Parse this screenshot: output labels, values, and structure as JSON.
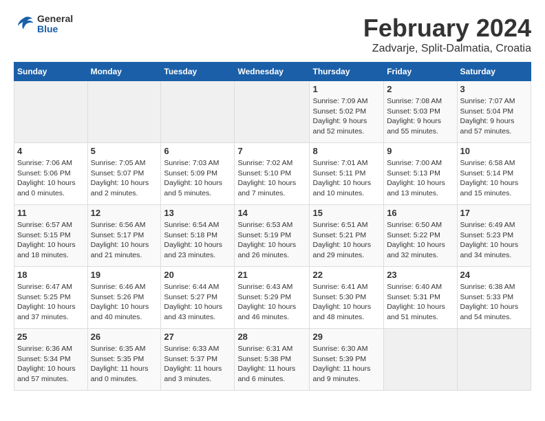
{
  "logo": {
    "general": "General",
    "blue": "Blue"
  },
  "header": {
    "month": "February 2024",
    "location": "Zadvarje, Split-Dalmatia, Croatia"
  },
  "weekdays": [
    "Sunday",
    "Monday",
    "Tuesday",
    "Wednesday",
    "Thursday",
    "Friday",
    "Saturday"
  ],
  "weeks": [
    [
      {
        "day": "",
        "info": ""
      },
      {
        "day": "",
        "info": ""
      },
      {
        "day": "",
        "info": ""
      },
      {
        "day": "",
        "info": ""
      },
      {
        "day": "1",
        "info": "Sunrise: 7:09 AM\nSunset: 5:02 PM\nDaylight: 9 hours\nand 52 minutes."
      },
      {
        "day": "2",
        "info": "Sunrise: 7:08 AM\nSunset: 5:03 PM\nDaylight: 9 hours\nand 55 minutes."
      },
      {
        "day": "3",
        "info": "Sunrise: 7:07 AM\nSunset: 5:04 PM\nDaylight: 9 hours\nand 57 minutes."
      }
    ],
    [
      {
        "day": "4",
        "info": "Sunrise: 7:06 AM\nSunset: 5:06 PM\nDaylight: 10 hours\nand 0 minutes."
      },
      {
        "day": "5",
        "info": "Sunrise: 7:05 AM\nSunset: 5:07 PM\nDaylight: 10 hours\nand 2 minutes."
      },
      {
        "day": "6",
        "info": "Sunrise: 7:03 AM\nSunset: 5:09 PM\nDaylight: 10 hours\nand 5 minutes."
      },
      {
        "day": "7",
        "info": "Sunrise: 7:02 AM\nSunset: 5:10 PM\nDaylight: 10 hours\nand 7 minutes."
      },
      {
        "day": "8",
        "info": "Sunrise: 7:01 AM\nSunset: 5:11 PM\nDaylight: 10 hours\nand 10 minutes."
      },
      {
        "day": "9",
        "info": "Sunrise: 7:00 AM\nSunset: 5:13 PM\nDaylight: 10 hours\nand 13 minutes."
      },
      {
        "day": "10",
        "info": "Sunrise: 6:58 AM\nSunset: 5:14 PM\nDaylight: 10 hours\nand 15 minutes."
      }
    ],
    [
      {
        "day": "11",
        "info": "Sunrise: 6:57 AM\nSunset: 5:15 PM\nDaylight: 10 hours\nand 18 minutes."
      },
      {
        "day": "12",
        "info": "Sunrise: 6:56 AM\nSunset: 5:17 PM\nDaylight: 10 hours\nand 21 minutes."
      },
      {
        "day": "13",
        "info": "Sunrise: 6:54 AM\nSunset: 5:18 PM\nDaylight: 10 hours\nand 23 minutes."
      },
      {
        "day": "14",
        "info": "Sunrise: 6:53 AM\nSunset: 5:19 PM\nDaylight: 10 hours\nand 26 minutes."
      },
      {
        "day": "15",
        "info": "Sunrise: 6:51 AM\nSunset: 5:21 PM\nDaylight: 10 hours\nand 29 minutes."
      },
      {
        "day": "16",
        "info": "Sunrise: 6:50 AM\nSunset: 5:22 PM\nDaylight: 10 hours\nand 32 minutes."
      },
      {
        "day": "17",
        "info": "Sunrise: 6:49 AM\nSunset: 5:23 PM\nDaylight: 10 hours\nand 34 minutes."
      }
    ],
    [
      {
        "day": "18",
        "info": "Sunrise: 6:47 AM\nSunset: 5:25 PM\nDaylight: 10 hours\nand 37 minutes."
      },
      {
        "day": "19",
        "info": "Sunrise: 6:46 AM\nSunset: 5:26 PM\nDaylight: 10 hours\nand 40 minutes."
      },
      {
        "day": "20",
        "info": "Sunrise: 6:44 AM\nSunset: 5:27 PM\nDaylight: 10 hours\nand 43 minutes."
      },
      {
        "day": "21",
        "info": "Sunrise: 6:43 AM\nSunset: 5:29 PM\nDaylight: 10 hours\nand 46 minutes."
      },
      {
        "day": "22",
        "info": "Sunrise: 6:41 AM\nSunset: 5:30 PM\nDaylight: 10 hours\nand 48 minutes."
      },
      {
        "day": "23",
        "info": "Sunrise: 6:40 AM\nSunset: 5:31 PM\nDaylight: 10 hours\nand 51 minutes."
      },
      {
        "day": "24",
        "info": "Sunrise: 6:38 AM\nSunset: 5:33 PM\nDaylight: 10 hours\nand 54 minutes."
      }
    ],
    [
      {
        "day": "25",
        "info": "Sunrise: 6:36 AM\nSunset: 5:34 PM\nDaylight: 10 hours\nand 57 minutes."
      },
      {
        "day": "26",
        "info": "Sunrise: 6:35 AM\nSunset: 5:35 PM\nDaylight: 11 hours\nand 0 minutes."
      },
      {
        "day": "27",
        "info": "Sunrise: 6:33 AM\nSunset: 5:37 PM\nDaylight: 11 hours\nand 3 minutes."
      },
      {
        "day": "28",
        "info": "Sunrise: 6:31 AM\nSunset: 5:38 PM\nDaylight: 11 hours\nand 6 minutes."
      },
      {
        "day": "29",
        "info": "Sunrise: 6:30 AM\nSunset: 5:39 PM\nDaylight: 11 hours\nand 9 minutes."
      },
      {
        "day": "",
        "info": ""
      },
      {
        "day": "",
        "info": ""
      }
    ]
  ]
}
